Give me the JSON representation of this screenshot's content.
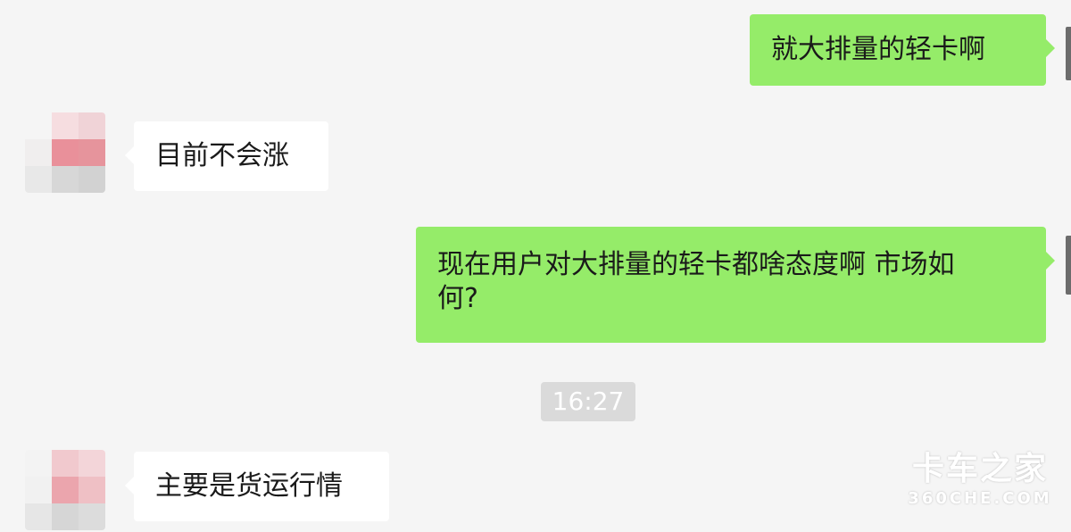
{
  "messages": [
    {
      "side": "me",
      "text": "就大排量的轻卡啊"
    },
    {
      "side": "them",
      "text": "目前不会涨"
    },
    {
      "side": "me",
      "text_lines": [
        "现在用户对大排量的轻卡都啥态度啊 市场如",
        "何?"
      ]
    },
    {
      "side": "them",
      "text": "主要是货运行情"
    }
  ],
  "timestamp": "16:27",
  "watermark": {
    "main": "卡车之家",
    "sub": "360CHE.COM"
  },
  "colors": {
    "background": "#f5f5f5",
    "outgoing_bubble": "#95ec69",
    "incoming_bubble": "#ffffff",
    "timestamp_badge": "#dadada"
  }
}
